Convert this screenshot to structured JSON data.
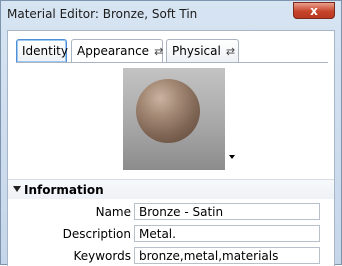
{
  "window": {
    "title": "Material Editor: Bronze, Soft Tin",
    "close_label": "x"
  },
  "tabs": [
    {
      "label": "Identity",
      "state": "focused"
    },
    {
      "label": "Appearance",
      "state": "selected",
      "icon": "swap-arrows-icon"
    },
    {
      "label": "Physical",
      "state": "normal",
      "icon": "swap-arrows-icon"
    }
  ],
  "preview": {
    "icon": "sphere-preview",
    "dropdown_icon": "chevron-down-icon"
  },
  "section": {
    "title": "Information",
    "expanded": true
  },
  "fields": [
    {
      "label": "Name",
      "value": "Bronze - Satin"
    },
    {
      "label": "Description",
      "value": "Metal."
    },
    {
      "label": "Keywords",
      "value": "bronze,metal,materials"
    }
  ],
  "colors": {
    "close_button": "#c7442b",
    "focused_tab_border": "#4f8fd6",
    "titlebar": "#d7e4f2"
  }
}
